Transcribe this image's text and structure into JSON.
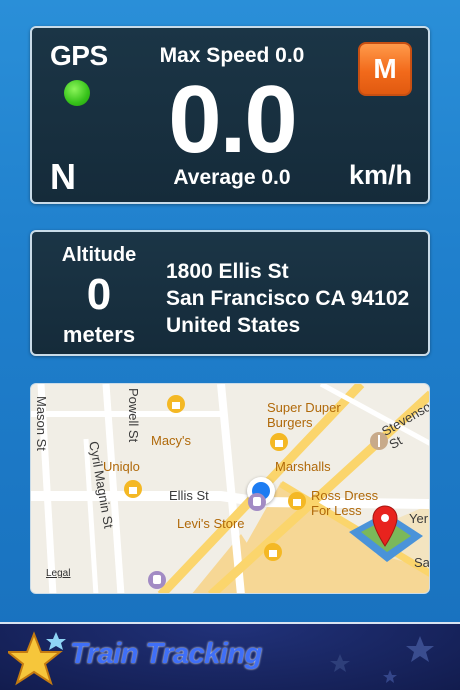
{
  "speedometer": {
    "gps_label": "GPS",
    "gps_status_color": "#39c21f",
    "heading": "N",
    "max_speed": "Max Speed 0.0",
    "speed": "0.0",
    "average": "Average 0.0",
    "unit": "km/h",
    "mode_button": "M"
  },
  "altitude": {
    "label": "Altitude",
    "value": "0",
    "unit": "meters"
  },
  "address": {
    "line1": "1800 Ellis St",
    "line2": "San Francisco CA 94102",
    "line3": "United States"
  },
  "map": {
    "streets": [
      "Mason St",
      "Powell St",
      "Cyril Magnin St",
      "Ellis St",
      "Stevenson St"
    ],
    "poi": [
      "Macy's",
      "Uniqlo",
      "Marshalls",
      "Super Duper Burgers",
      "Ross Dress For Less",
      "Levi's Store"
    ],
    "edge_text": [
      "Yer",
      "Sa"
    ],
    "legal": "Legal"
  },
  "banner": {
    "title": "Train Tracking"
  },
  "colors": {
    "background": "#1f7fcc",
    "panel": "#1b3546",
    "accent_orange": "#f26a1b",
    "location_blue": "#1d7cf2"
  }
}
